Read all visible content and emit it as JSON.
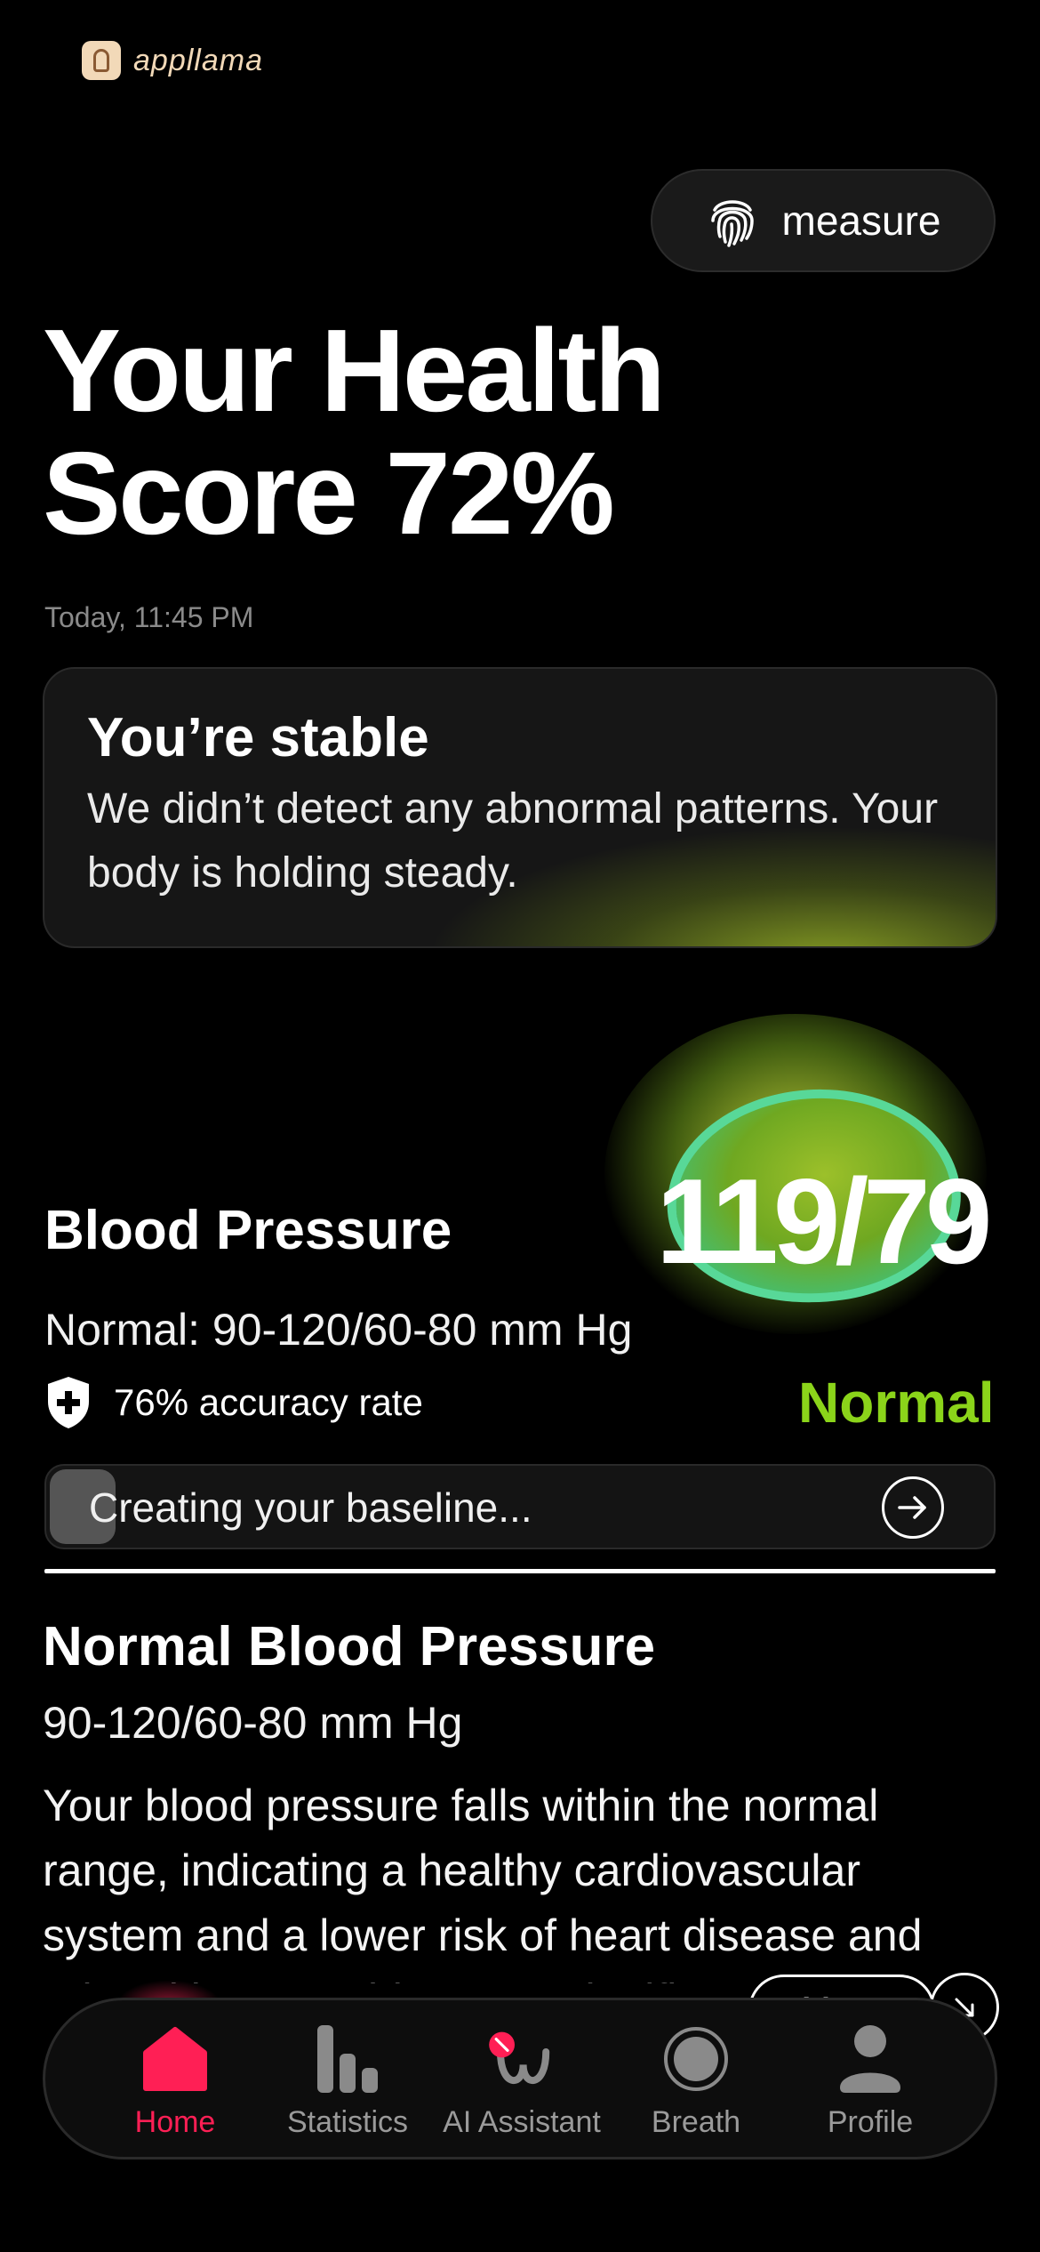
{
  "app": {
    "logo_text": "appllama"
  },
  "header": {
    "measure_label": "measure"
  },
  "hero": {
    "headline_line1": "Your Health",
    "headline_line2": "Score 72%",
    "timestamp": "Today, 11:45 PM"
  },
  "status_card": {
    "title": "You’re stable",
    "body": "We didn’t detect any abnormal patterns. Your body is holding steady."
  },
  "blood_pressure": {
    "title": "Blood Pressure",
    "value": "119/79",
    "normal_range": "Normal: 90-120/60-80 mm Hg",
    "accuracy": "76% accuracy rate",
    "status": "Normal",
    "baseline_text": "Creating your baseline...",
    "baseline_progress": 0.07
  },
  "info": {
    "title": "Normal Blood Pressure",
    "range": "90-120/60-80 mm Hg",
    "body": " Your blood pressure falls within the normal range, indicating a healthy cardiovascular system and a lower risk of heart disease and related issues. This range signifies",
    "more_label": "More"
  },
  "tabbar": {
    "items": [
      {
        "label": "Home",
        "icon": "home-icon",
        "active": true
      },
      {
        "label": "Statistics",
        "icon": "statistics-icon",
        "active": false
      },
      {
        "label": "AI Assistant",
        "icon": "ai-assistant-icon",
        "active": false
      },
      {
        "label": "Breath",
        "icon": "breath-icon",
        "active": false
      },
      {
        "label": "Profile",
        "icon": "profile-icon",
        "active": false
      }
    ]
  },
  "colors": {
    "accent_red": "#ff1f55",
    "status_green": "#8bd41a"
  }
}
